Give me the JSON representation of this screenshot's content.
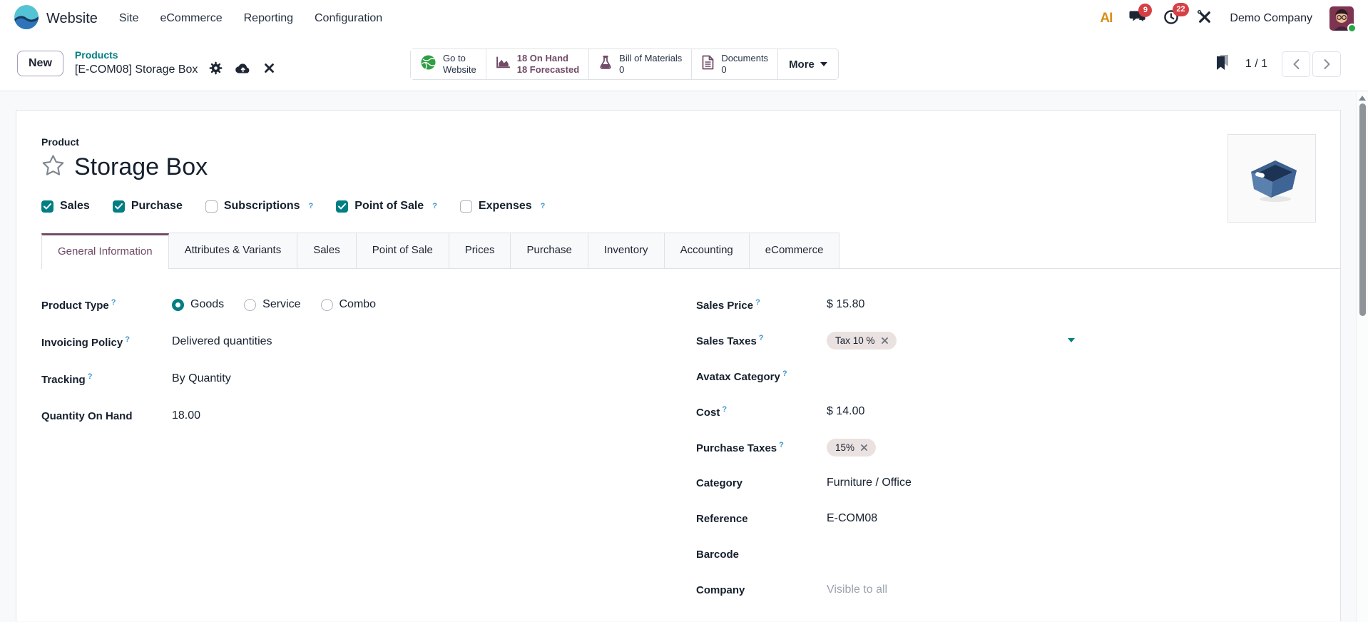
{
  "nav": {
    "app": "Website",
    "menus": [
      "Site",
      "eCommerce",
      "Reporting",
      "Configuration"
    ],
    "ai": "AI",
    "messages_count": "9",
    "activities_count": "22",
    "company": "Demo Company"
  },
  "control": {
    "new_label": "New",
    "breadcrumb_parent": "Products",
    "breadcrumb_current": "[E-COM08] Storage Box",
    "stats": [
      {
        "l1": "Go to",
        "l2": "Website"
      },
      {
        "l1": "18 On Hand",
        "l2": "18 Forecasted"
      },
      {
        "l1": "Bill of Materials",
        "l2": "0"
      },
      {
        "l1": "Documents",
        "l2": "0"
      }
    ],
    "more_label": "More",
    "pager": "1 / 1"
  },
  "sheet": {
    "kicker": "Product",
    "title": "Storage Box",
    "help_symbol": "?",
    "toggles": [
      {
        "label": "Sales",
        "checked": true,
        "help": false
      },
      {
        "label": "Purchase",
        "checked": true,
        "help": false
      },
      {
        "label": "Subscriptions",
        "checked": false,
        "help": true
      },
      {
        "label": "Point of Sale",
        "checked": true,
        "help": true
      },
      {
        "label": "Expenses",
        "checked": false,
        "help": true
      }
    ],
    "tabs": [
      {
        "label": "General Information",
        "active": true
      },
      {
        "label": "Attributes & Variants",
        "active": false
      },
      {
        "label": "Sales",
        "active": false
      },
      {
        "label": "Point of Sale",
        "active": false
      },
      {
        "label": "Prices",
        "active": false
      },
      {
        "label": "Purchase",
        "active": false
      },
      {
        "label": "Inventory",
        "active": false
      },
      {
        "label": "Accounting",
        "active": false
      },
      {
        "label": "eCommerce",
        "active": false
      }
    ],
    "radio": {
      "options": [
        {
          "label": "Goods",
          "selected": true
        },
        {
          "label": "Service",
          "selected": false
        },
        {
          "label": "Combo",
          "selected": false
        }
      ]
    },
    "left": [
      {
        "label": "Product Type"
      },
      {
        "label": "Invoicing Policy",
        "value": "Delivered quantities"
      },
      {
        "label": "Tracking",
        "value": "By Quantity"
      },
      {
        "label": "Quantity On Hand",
        "value": "18.00"
      }
    ],
    "right": [
      {
        "label": "Sales Price",
        "value": "$ 15.80"
      },
      {
        "label": "Sales Taxes",
        "tag": "Tax 10 %"
      },
      {
        "label": "Avatax Category",
        "value": ""
      },
      {
        "label": "Cost",
        "value": "$ 14.00"
      },
      {
        "label": "Purchase Taxes",
        "tag": "15%"
      },
      {
        "label": "Category",
        "value": "Furniture / Office"
      },
      {
        "label": "Reference",
        "value": "E-COM08"
      },
      {
        "label": "Barcode",
        "value": ""
      },
      {
        "label": "Company",
        "placeholder": "Visible to all"
      }
    ]
  },
  "colors": {
    "accent_teal": "#017E84",
    "primary_purple": "#714B67",
    "badge_red": "#D64045",
    "globe_green": "#2F9E44"
  }
}
